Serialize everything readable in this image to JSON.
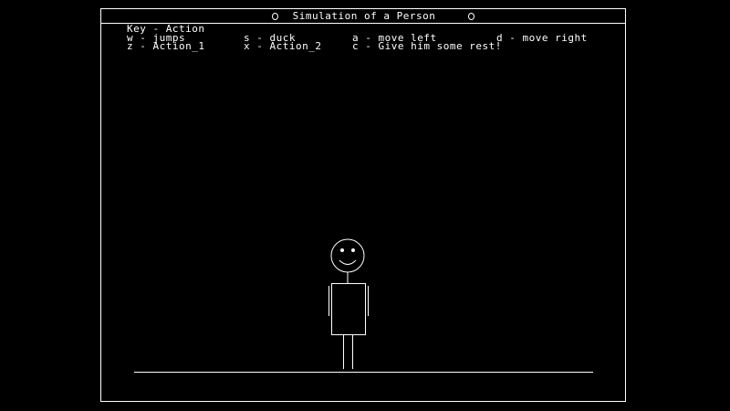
{
  "window": {
    "title": "Simulation of a Person"
  },
  "key_header": "Key - Action",
  "controls": [
    {
      "key": "w",
      "action": "jumps"
    },
    {
      "key": "s",
      "action": "duck"
    },
    {
      "key": "a",
      "action": "move left"
    },
    {
      "key": "d",
      "action": "move right"
    },
    {
      "key": "z",
      "action": "Action_1"
    },
    {
      "key": "x",
      "action": "Action_2"
    },
    {
      "key": "c",
      "action": "Give him some rest!"
    }
  ],
  "labels": {
    "w": "w - jumps",
    "s": "s - duck",
    "a": "a - move left",
    "d": "d - move right",
    "z": "z - Action_1",
    "x": "x - Action_2",
    "c": "c - Give him some rest!"
  },
  "colors": {
    "background": "#000000",
    "foreground": "#ffffff"
  }
}
